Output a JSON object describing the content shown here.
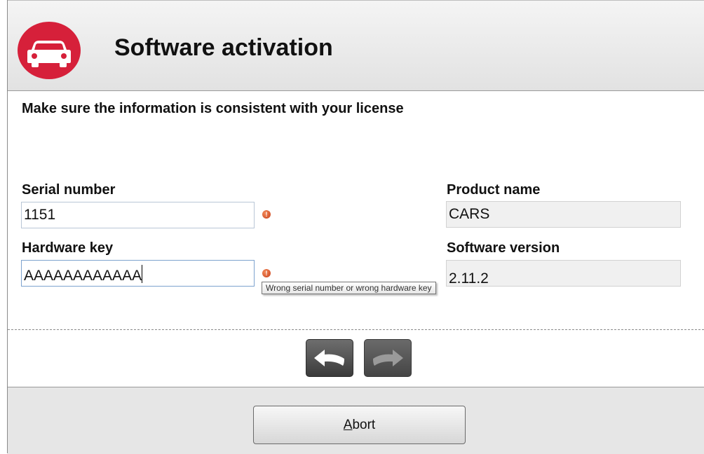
{
  "header": {
    "title": "Software activation",
    "logo_icon": "car-icon",
    "logo_color": "#d6203a"
  },
  "subtitle": "Make sure the information is consistent with your license",
  "form": {
    "serial_label": "Serial number",
    "serial_value": "1151",
    "hardware_label": "Hardware key",
    "hardware_value": "AAAAAAAAAAAA",
    "product_label": "Product name",
    "product_value": "CARS",
    "version_label": "Software version",
    "version_value": "2.11.2",
    "error_icon": "error-icon",
    "error_tooltip": "Wrong serial number or wrong hardware key"
  },
  "nav": {
    "back_icon": "back-arrow-icon",
    "next_icon": "forward-arrow-icon"
  },
  "footer": {
    "abort_mnemonic": "A",
    "abort_rest": "bort"
  }
}
